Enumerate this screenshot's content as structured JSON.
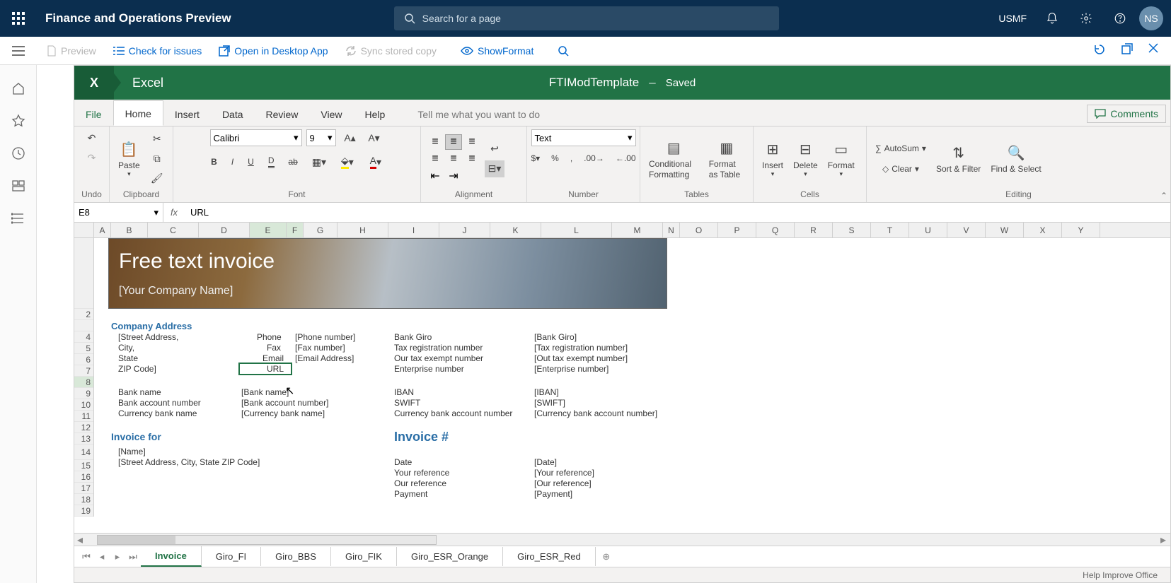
{
  "topbar": {
    "title": "Finance and Operations Preview",
    "search_placeholder": "Search for a page",
    "company": "USMF",
    "avatar": "NS"
  },
  "subbar": {
    "preview": "Preview",
    "check": "Check for issues",
    "open_desktop": "Open in Desktop App",
    "sync": "Sync stored copy",
    "show_format": "ShowFormat"
  },
  "excel": {
    "app": "Excel",
    "file": "FTIModTemplate",
    "saved": "Saved",
    "menu": {
      "file": "File",
      "home": "Home",
      "insert": "Insert",
      "data": "Data",
      "review": "Review",
      "view": "View",
      "help": "Help",
      "tellme": "Tell me what you want to do",
      "comments": "Comments"
    },
    "ribbon": {
      "undo": "Undo",
      "paste": "Paste",
      "clipboard": "Clipboard",
      "font_name": "Calibri",
      "font_size": "9",
      "font": "Font",
      "alignment": "Alignment",
      "number": "Number",
      "tables": "Tables",
      "cells": "Cells",
      "editing": "Editing",
      "numfmt": "Text",
      "cond_fmt": "Conditional Formatting",
      "fmt_table": "Format as Table",
      "insert": "Insert",
      "delete": "Delete",
      "format": "Format",
      "autosum": "AutoSum",
      "clear": "Clear",
      "sort": "Sort & Filter",
      "find": "Find & Select"
    },
    "namebox": "E8",
    "formula": "URL",
    "cols": [
      "",
      "A",
      "B",
      "C",
      "D",
      "E",
      "F",
      "G",
      "H",
      "I",
      "J",
      "K",
      "L",
      "M",
      "N",
      "O",
      "P",
      "Q",
      "R",
      "S",
      "T",
      "U",
      "V",
      "W",
      "X",
      "Y"
    ],
    "sheet": {
      "banner_title": "Free text invoice",
      "banner_sub": "[Your Company Name]",
      "company_address": "Company Address",
      "r5": {
        "addr": "[Street Address,",
        "phone_l": "Phone",
        "phone_v": "[Phone number]",
        "bankgiro_l": "Bank Giro",
        "bankgiro_v": "[Bank Giro]"
      },
      "r6": {
        "addr": "City,",
        "fax_l": "Fax",
        "fax_v": "[Fax number]",
        "tax_l": "Tax registration number",
        "tax_v": "[Tax registration number]"
      },
      "r7": {
        "addr": "State",
        "email_l": "Email",
        "email_v": "[Email Address]",
        "exempt_l": "Our tax exempt number",
        "exempt_v": "[Out tax exempt number]"
      },
      "r8": {
        "addr": "ZIP Code]",
        "url_l": "URL",
        "ent_l": "Enterprise number",
        "ent_v": "[Enterprise number]"
      },
      "r10": {
        "bank_l": "Bank name",
        "bank_v": "[Bank name]",
        "iban_l": "IBAN",
        "iban_v": "[IBAN]"
      },
      "r11": {
        "acct_l": "Bank account number",
        "acct_v": "[Bank account number]",
        "swift_l": "SWIFT",
        "swift_v": "[SWIFT]"
      },
      "r12": {
        "curr_l": "Currency bank name",
        "curr_v": "[Currency bank name]",
        "cacct_l": "Currency bank account number",
        "cacct_v": "[Currency bank account number]"
      },
      "invoice_for": "Invoice for",
      "invoice_num": "Invoice #",
      "r15": {
        "name": "[Name]"
      },
      "r16": {
        "addr": "[Street Address, City, State ZIP Code]",
        "date_l": "Date",
        "date_v": "[Date]"
      },
      "r17": {
        "yourref_l": "Your reference",
        "yourref_v": "[Your reference]"
      },
      "r18": {
        "ourref_l": "Our reference",
        "ourref_v": "[Our reference]"
      },
      "r19": {
        "pay_l": "Payment",
        "pay_v": "[Payment]"
      }
    },
    "tabs": [
      "Invoice",
      "Giro_FI",
      "Giro_BBS",
      "Giro_FIK",
      "Giro_ESR_Orange",
      "Giro_ESR_Red"
    ],
    "status": "Help Improve Office"
  }
}
